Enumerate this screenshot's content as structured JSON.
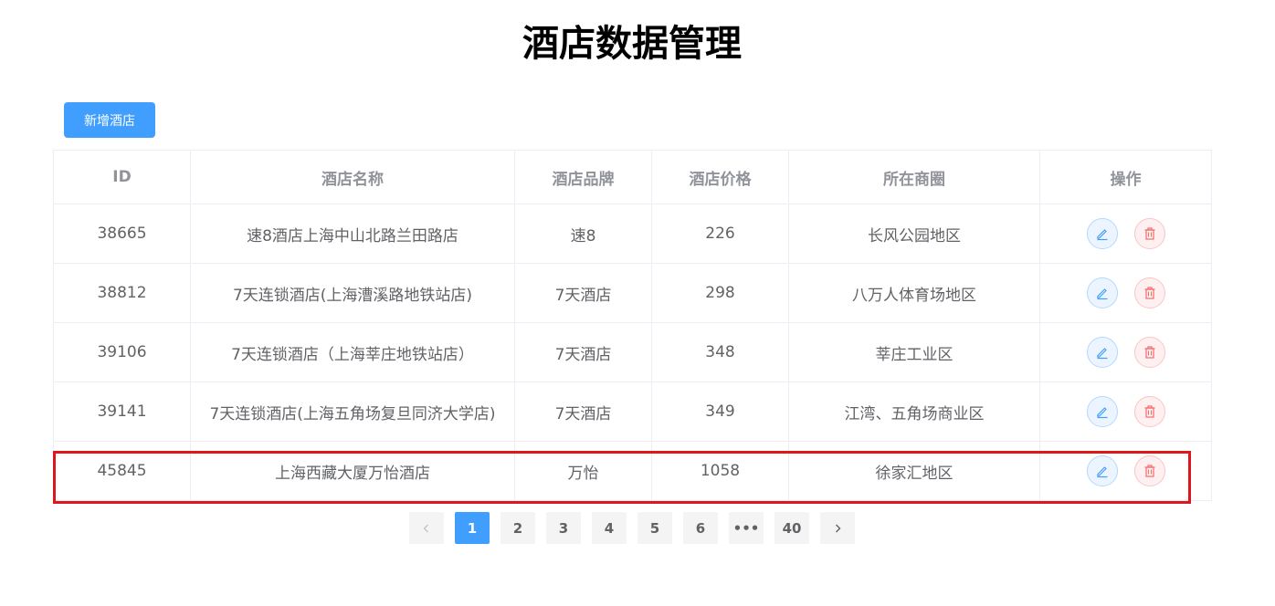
{
  "page": {
    "title": "酒店数据管理"
  },
  "toolbar": {
    "add_label": "新增酒店"
  },
  "table": {
    "headers": [
      "ID",
      "酒店名称",
      "酒店品牌",
      "酒店价格",
      "所在商圈",
      "操作"
    ],
    "rows": [
      {
        "id": "38665",
        "name": "速8酒店上海中山北路兰田路店",
        "brand": "速8",
        "price": "226",
        "area": "长风公园地区"
      },
      {
        "id": "38812",
        "name": "7天连锁酒店(上海漕溪路地铁站店)",
        "brand": "7天酒店",
        "price": "298",
        "area": "八万人体育场地区"
      },
      {
        "id": "39106",
        "name": "7天连锁酒店（上海莘庄地铁站店）",
        "brand": "7天酒店",
        "price": "348",
        "area": "莘庄工业区"
      },
      {
        "id": "39141",
        "name": "7天连锁酒店(上海五角场复旦同济大学店)",
        "brand": "7天酒店",
        "price": "349",
        "area": "江湾、五角场商业区"
      },
      {
        "id": "45845",
        "name": "上海西藏大厦万怡酒店",
        "brand": "万怡",
        "price": "1058",
        "area": "徐家汇地区"
      }
    ]
  },
  "icons": {
    "edit": "pencil-icon",
    "delete": "trash-icon",
    "prev": "chevron-left-icon",
    "next": "chevron-right-icon"
  },
  "colors": {
    "primary": "#409eff",
    "danger": "#f56c6c",
    "highlight": "#e0161d"
  },
  "pagination": {
    "current": "1",
    "pages": [
      "1",
      "2",
      "3",
      "4",
      "5",
      "6",
      "•••",
      "40"
    ]
  }
}
